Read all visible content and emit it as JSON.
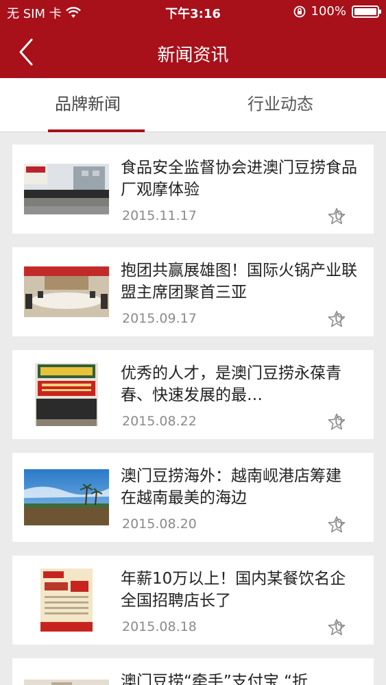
{
  "status_bar": {
    "carrier": "无 SIM 卡",
    "time": "下午3:16",
    "battery": "100%"
  },
  "nav": {
    "title": "新闻资讯"
  },
  "tabs": [
    {
      "label": "品牌新闻",
      "active": true
    },
    {
      "label": "行业动态",
      "active": false
    }
  ],
  "news": [
    {
      "title": "食品安全监督协会进澳门豆捞食品厂观摩体验",
      "date": "2015.11.17",
      "favorites": "0"
    },
    {
      "title": "抱团共赢展雄图！国际火锅产业联盟主席团聚首三亚",
      "date": "2015.09.17",
      "favorites": "0"
    },
    {
      "title": "优秀的人才，是澳门豆捞永葆青春、快速发展的最…",
      "date": "2015.08.22",
      "favorites": "0"
    },
    {
      "title": "澳门豆捞海外：越南岘港店筹建 在越南最美的海边",
      "date": "2015.08.20",
      "favorites": "0"
    },
    {
      "title": "年薪10万以上！国内某餐饮名企全国招聘店长了",
      "date": "2015.08.18",
      "favorites": "0"
    },
    {
      "title": "澳门豆捞“牵手”支付宝 “折",
      "date": "",
      "favorites": ""
    }
  ],
  "colors": {
    "brand": "#a8101a",
    "background": "#ebebeb"
  }
}
